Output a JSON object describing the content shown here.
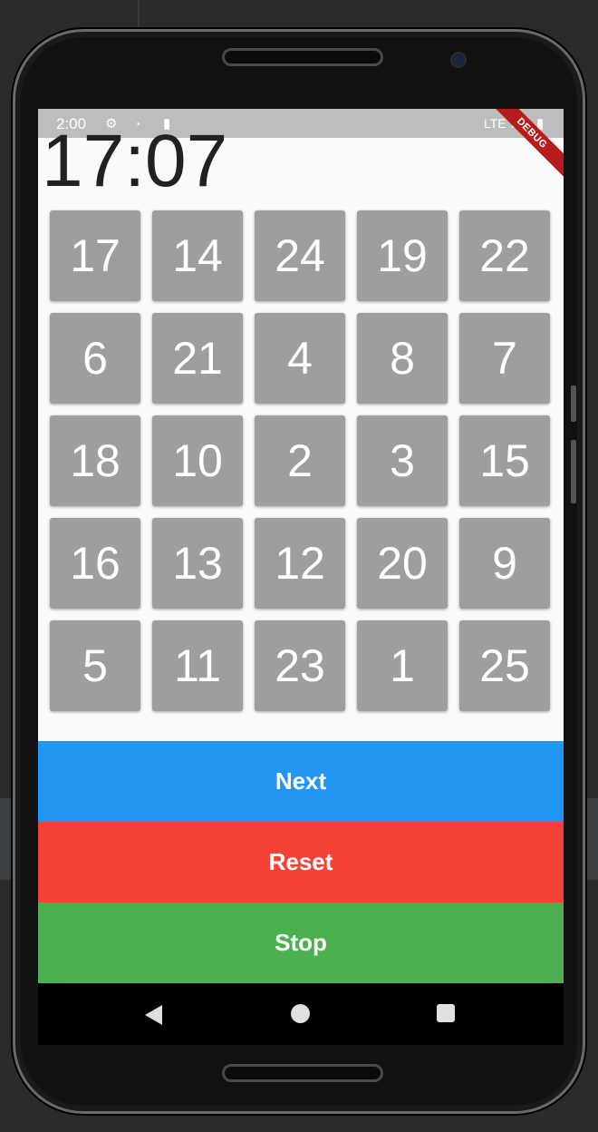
{
  "status_bar": {
    "time": "2:00",
    "icons": [
      "settings-icon",
      "wifi-unknown-icon",
      "sd-card-icon",
      "battery-charging-icon",
      "signal-icon"
    ],
    "network": "LTE",
    "debug_label": "DEBUG"
  },
  "clock": "17:07",
  "tiles": [
    "17",
    "14",
    "24",
    "19",
    "22",
    "6",
    "21",
    "4",
    "8",
    "7",
    "18",
    "10",
    "2",
    "3",
    "15",
    "16",
    "13",
    "12",
    "20",
    "9",
    "5",
    "11",
    "23",
    "1",
    "25"
  ],
  "buttons": {
    "next": "Next",
    "reset": "Reset",
    "stop": "Stop"
  },
  "colors": {
    "tile": "#9e9e9e",
    "next": "#2196f3",
    "reset": "#f44336",
    "stop": "#4caf50"
  },
  "nav": [
    "back-icon",
    "home-icon",
    "recents-icon"
  ]
}
